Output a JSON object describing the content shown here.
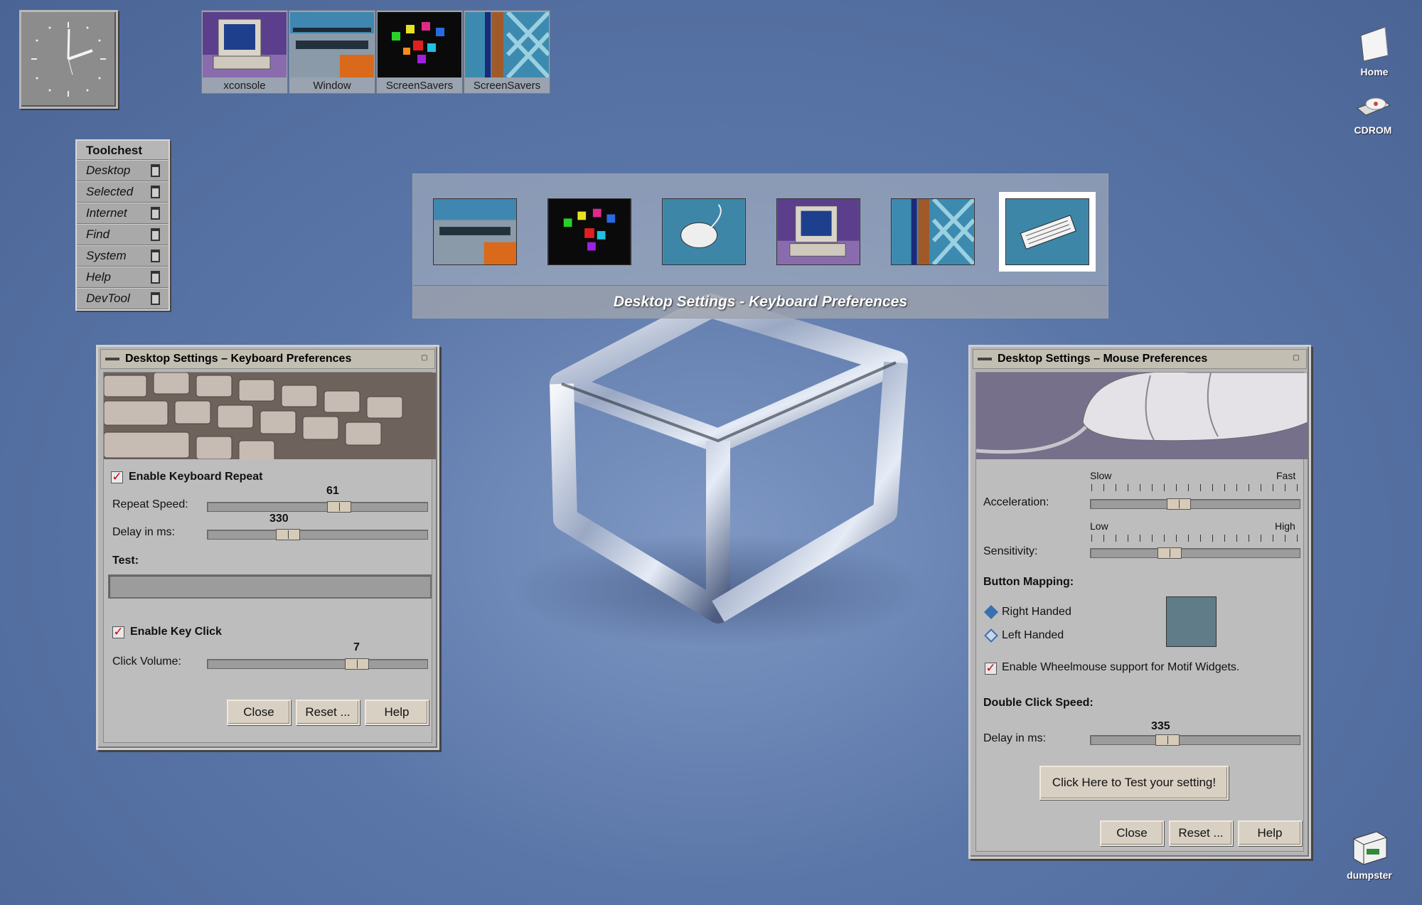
{
  "panel": {
    "icons": [
      {
        "label": "xconsole",
        "icon": "computer-monitor-icon"
      },
      {
        "label": "Window",
        "icon": "window-server-icon"
      },
      {
        "label": "ScreenSavers",
        "icon": "screensaver-cubes-icon"
      },
      {
        "label": "ScreenSavers",
        "icon": "screensaver-weave-icon"
      }
    ]
  },
  "toolchest": {
    "title": "Toolchest",
    "items": [
      "Desktop",
      "Selected",
      "Internet",
      "Find",
      "System",
      "Help",
      "DevTool"
    ]
  },
  "desks": {
    "caption": "Desktop Settings - Keyboard Preferences",
    "thumbnails": [
      "window-server-icon",
      "screensaver-cubes-icon",
      "mouse-icon",
      "computer-monitor-icon",
      "screensaver-weave-icon",
      "keyboard-icon"
    ],
    "selected_index": 5
  },
  "keyboard_window": {
    "title": "Desktop Settings – Keyboard Preferences",
    "enable_repeat_label": "Enable Keyboard Repeat",
    "enable_repeat_checked": true,
    "repeat_speed_label": "Repeat Speed:",
    "repeat_speed_value": "61",
    "repeat_speed_fraction": 0.61,
    "delay_label": "Delay in ms:",
    "delay_value": "330",
    "delay_fraction": 0.35,
    "test_label": "Test:",
    "test_value": "",
    "enable_click_label": "Enable Key Click",
    "enable_click_checked": true,
    "click_volume_label": "Click Volume:",
    "click_volume_value": "7",
    "click_volume_fraction": 0.7,
    "close_label": "Close",
    "reset_label": "Reset ...",
    "help_label": "Help"
  },
  "mouse_window": {
    "title": "Desktop Settings – Mouse Preferences",
    "slow_label": "Slow",
    "fast_label": "Fast",
    "acceleration_label": "Acceleration:",
    "acceleration_fraction": 0.41,
    "low_label": "Low",
    "high_label": "High",
    "sensitivity_label": "Sensitivity:",
    "sensitivity_fraction": 0.36,
    "button_mapping_label": "Button Mapping:",
    "right_handed_label": "Right Handed",
    "left_handed_label": "Left Handed",
    "selected_mapping": "Right Handed",
    "wheelmouse_label": "Enable Wheelmouse support for Motif Widgets.",
    "wheelmouse_checked": true,
    "double_click_label": "Double Click Speed:",
    "delay_label": "Delay in ms:",
    "delay_value": "335",
    "delay_fraction": 0.35,
    "test_button_label": "Click Here to Test your setting!",
    "close_label": "Close",
    "reset_label": "Reset ...",
    "help_label": "Help"
  },
  "desktop_icons": [
    {
      "label": "Home",
      "icon": "home-folder-icon"
    },
    {
      "label": "CDROM",
      "icon": "cdrom-icon"
    },
    {
      "label": "dumpster",
      "icon": "dumpster-icon"
    }
  ],
  "colors": {
    "desktop_bg": "#5a76a8",
    "window_bg": "#bdbdbd",
    "titlebar": "#c2bfb2",
    "button": "#d9d0c4",
    "check_mark": "#cc0000",
    "mapping_swatch": "#5f7c88"
  }
}
